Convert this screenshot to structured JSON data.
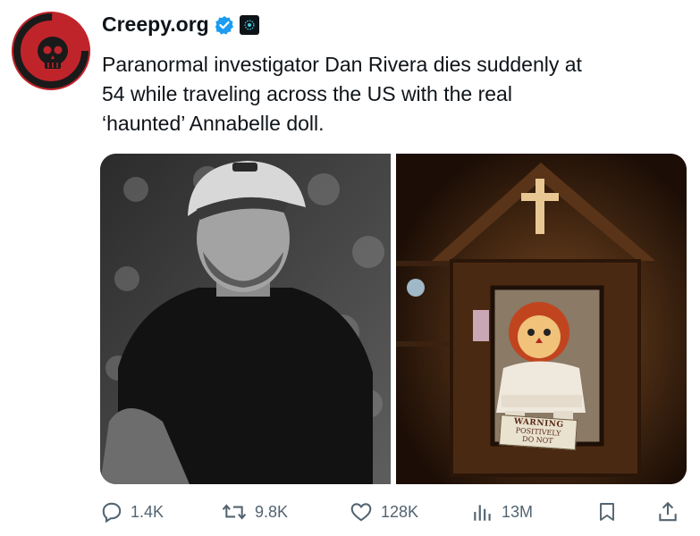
{
  "post": {
    "author": "Creepy.org",
    "text": "Paranormal investigator Dan Rivera dies suddenly at\n54 while traveling across the US with the real\n‘haunted’ Annabelle doll."
  },
  "media": {
    "warning_sign": {
      "line1": "WARNING",
      "line2": "POSITIVELY",
      "line3": "DO NOT"
    }
  },
  "metrics": {
    "replies": "1.4K",
    "reposts": "9.8K",
    "likes": "128K",
    "views": "13M"
  },
  "colors": {
    "text": "#0f1419",
    "muted": "#536471",
    "verified": "#1d9bf0",
    "avatar": "#c0242b"
  },
  "icons": {
    "reply": "reply-icon",
    "repost": "repost-icon",
    "like": "heart-icon",
    "views": "views-icon",
    "bookmark": "bookmark-icon",
    "share": "share-icon"
  }
}
